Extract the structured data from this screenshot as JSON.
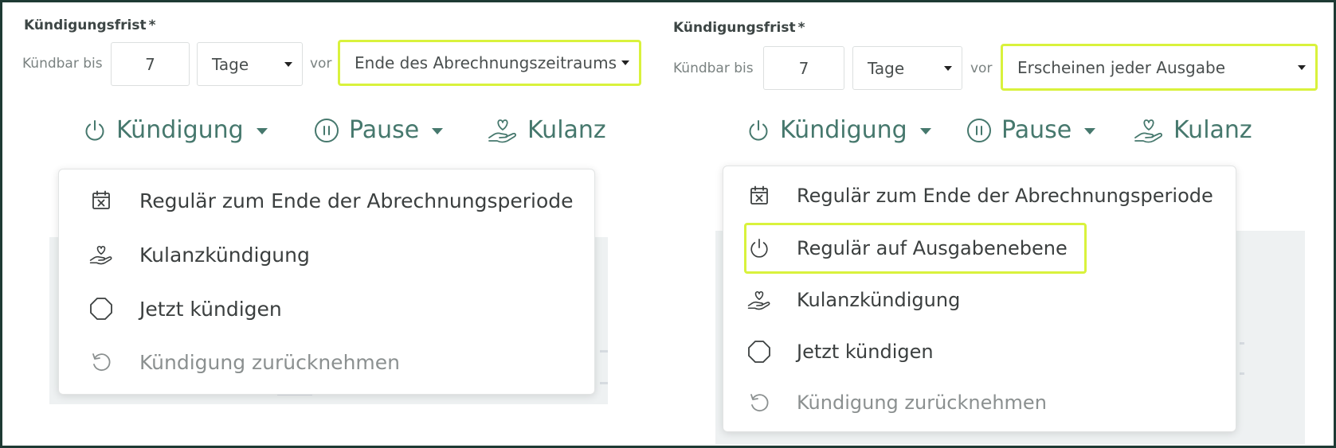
{
  "colors": {
    "accent": "#46786d",
    "highlight": "#d9f23c",
    "frame": "#1e3a34",
    "text": "#3b3f3f",
    "disabled": "#8b9090"
  },
  "left": {
    "notice_label": "Kündigungsfrist",
    "required_mark": "*",
    "cancel_until": "Kündbar bis",
    "amount": "7",
    "unit": "Tage",
    "before": "vor",
    "reference": "Ende des Abrechnungszeitraums",
    "actions": {
      "cancel": "Kündigung",
      "pause": "Pause",
      "goodwill": "Kulanz"
    },
    "menu": [
      {
        "icon": "calendar-x-icon",
        "label": "Regulär zum Ende der Abrechnungsperiode"
      },
      {
        "icon": "heart-hand-icon",
        "label": "Kulanzkündigung"
      },
      {
        "icon": "octagon-icon",
        "label": "Jetzt kündigen"
      },
      {
        "icon": "undo-icon",
        "label": "Kündigung zurücknehmen",
        "disabled": true
      }
    ]
  },
  "right": {
    "notice_label": "Kündigungsfrist",
    "required_mark": "*",
    "cancel_until": "Kündbar bis",
    "amount": "7",
    "unit": "Tage",
    "before": "vor",
    "reference": "Erscheinen jeder Ausgabe",
    "actions": {
      "cancel": "Kündigung",
      "pause": "Pause",
      "goodwill": "Kulanz"
    },
    "menu": [
      {
        "icon": "calendar-x-icon",
        "label": "Regulär zum Ende der Abrechnungsperiode"
      },
      {
        "icon": "power-icon",
        "label": "Regulär auf Ausgabenebene",
        "highlighted": true
      },
      {
        "icon": "heart-hand-icon",
        "label": "Kulanzkündigung"
      },
      {
        "icon": "octagon-icon",
        "label": "Jetzt kündigen"
      },
      {
        "icon": "undo-icon",
        "label": "Kündigung zurücknehmen",
        "disabled": true
      }
    ]
  }
}
